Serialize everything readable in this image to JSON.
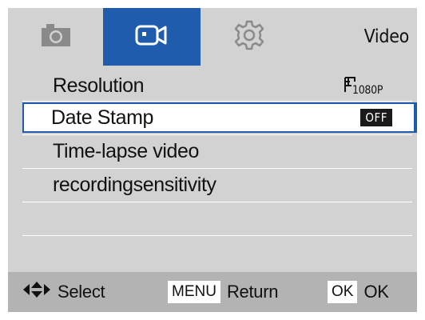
{
  "header": {
    "tabs": [
      {
        "name": "photo",
        "icon": "camera-icon",
        "selected": false
      },
      {
        "name": "video",
        "icon": "video-camera-icon",
        "selected": true
      },
      {
        "name": "settings",
        "icon": "gear-icon",
        "selected": false
      }
    ],
    "title": "Video"
  },
  "menu": {
    "items": [
      {
        "label": "Resolution",
        "value_icon": "resolution-1080p-icon",
        "value_text": "1080P"
      },
      {
        "label": "Date Stamp",
        "value": "OFF",
        "selected": true
      },
      {
        "label": "Time-lapse video"
      },
      {
        "label": "recordingsensitivity"
      }
    ]
  },
  "footer": {
    "select_icon": "dpad-arrows-icon",
    "select_label": "Select",
    "menu_key": "MENU",
    "return_label": "Return",
    "ok_key": "OK",
    "ok_label": "OK"
  },
  "colors": {
    "accent": "#1f5cae",
    "background": "#d2d2d2",
    "footer": "#b3b3b3"
  }
}
